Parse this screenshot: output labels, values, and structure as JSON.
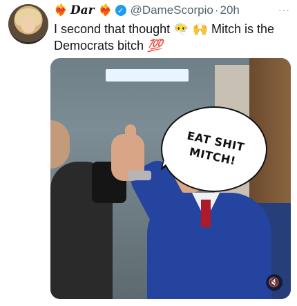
{
  "author": {
    "display_name": "Dar",
    "handle": "@DameScorpio",
    "timestamp": "20h",
    "verified_icon": "verified-badge-icon",
    "name_emoji_left": "❤️‍🔥",
    "name_emoji_right": "❤️‍🔥"
  },
  "tweet": {
    "text_line1": "I second that thought",
    "emoji_1": "😶‍🌫️",
    "emoji_2": "🙌",
    "text_line1b": "Mitch is the",
    "text_line2": "Democrats bitch",
    "emoji_3": "💯"
  },
  "media": {
    "caption": "EAT SHIT MITCH!",
    "mute_icon": "mute-icon"
  },
  "menu": {
    "more_label": "···"
  }
}
